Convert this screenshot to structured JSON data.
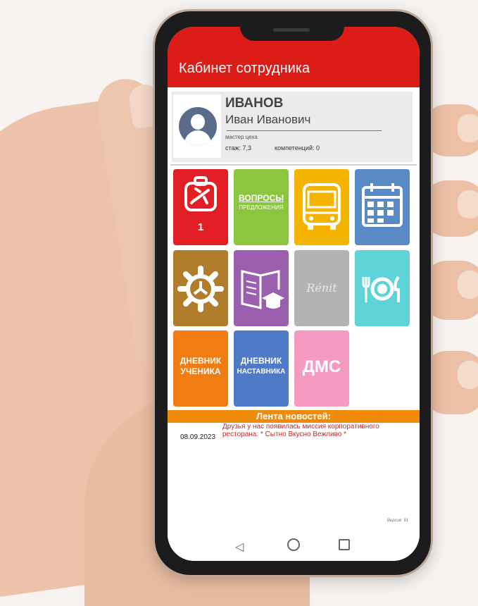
{
  "app": {
    "title": "Кабинет сотрудника"
  },
  "profile": {
    "surname": "ИВАНОВ",
    "fullname": "Иван Иванович",
    "position": "мастер цеха",
    "stazh": "стаж: 7,3",
    "competencies": "компетенций: 0"
  },
  "tiles": [
    {
      "name": "vacation",
      "color": "#e31e24",
      "icon": "airplane-suitcase-icon",
      "badge": "1"
    },
    {
      "name": "questions",
      "color": "#8cc63f",
      "title": "ВОПРОСЫ",
      "subtitle": "ПРЕДЛОЖЕНИЯ"
    },
    {
      "name": "transport",
      "color": "#f4b400",
      "icon": "bus-icon"
    },
    {
      "name": "calendar",
      "color": "#5a8ac6",
      "icon": "calendar-icon"
    },
    {
      "name": "settings",
      "color": "#b07d2b",
      "icon": "gear-icon"
    },
    {
      "name": "education",
      "color": "#9b5fb0",
      "icon": "book-graduation-icon"
    },
    {
      "name": "restaurant-logo",
      "color": "#b3b3b3",
      "icon": "script-logo"
    },
    {
      "name": "canteen",
      "color": "#5fd4d8",
      "icon": "plate-fork-knife-icon"
    },
    {
      "name": "student-diary",
      "color": "#f07c12",
      "line1": "ДНЕВНИК",
      "line2": "УЧЕНИКА"
    },
    {
      "name": "mentor-diary",
      "color": "#4f7ac7",
      "line1": "ДНЕВНИК",
      "line2": "НАСТАВНИКА"
    },
    {
      "name": "dms",
      "color": "#f59ac0",
      "title": "ДМС"
    }
  ],
  "news": {
    "header": "Лента новостей:",
    "date": "08.09.2023",
    "text": "Друзья у нас появилась миссия корпоративного ресторана:  * Сытно Вкусно Вежливо *"
  },
  "version": "Версия: 91",
  "nav": {
    "back": "◁",
    "home": "home",
    "recent": "recent"
  }
}
